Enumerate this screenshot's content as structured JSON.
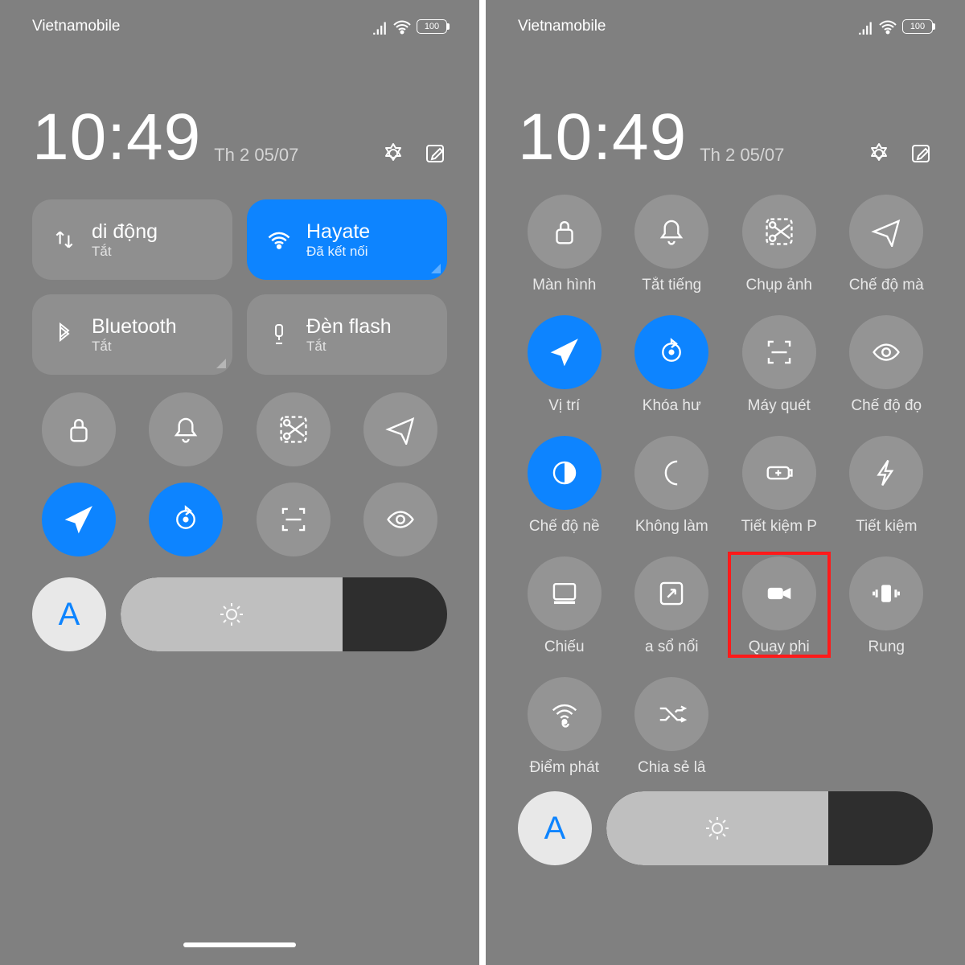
{
  "status": {
    "carrier": "Vietnamobile",
    "battery": "100"
  },
  "header": {
    "time": "10:49",
    "date": "Th 2 05/07"
  },
  "left": {
    "tiles": [
      {
        "title": "di động",
        "sub": "Tắt"
      },
      {
        "title": "Hayate",
        "sub": "Đã kết nối"
      },
      {
        "title": "Bluetooth",
        "sub": "Tắt"
      },
      {
        "title": "Đèn flash",
        "sub": "Tắt"
      }
    ],
    "auto_label": "A"
  },
  "right": {
    "toggles": [
      {
        "label": "Màn hình",
        "icon": "lock"
      },
      {
        "label": "Tắt tiếng",
        "icon": "bell"
      },
      {
        "label": "Chụp ảnh",
        "icon": "scissors"
      },
      {
        "label": "Chế độ mà",
        "icon": "plane"
      },
      {
        "label": "Vị trí",
        "icon": "location",
        "active": true
      },
      {
        "label": "Khóa hư",
        "icon": "rotate",
        "active": true
      },
      {
        "label": "Máy quét",
        "icon": "scan"
      },
      {
        "label": "Chế độ đọ",
        "icon": "eye"
      },
      {
        "label": "Chế độ nề",
        "icon": "contrast",
        "active": true
      },
      {
        "label": "Không làm",
        "icon": "moon"
      },
      {
        "label": "Tiết kiệm P",
        "icon": "battery-plus"
      },
      {
        "label": "Tiết kiệm",
        "icon": "bolt"
      },
      {
        "label": "Chiếu",
        "icon": "cast"
      },
      {
        "label": "a sổ nổi",
        "icon": "expand"
      },
      {
        "label": "Quay phi",
        "icon": "video",
        "highlight": true
      },
      {
        "label": "Rung",
        "icon": "vibrate"
      },
      {
        "label": "Điểm phát",
        "icon": "hotspot"
      },
      {
        "label": "Chia sẻ lâ",
        "icon": "shuffle"
      }
    ],
    "auto_label": "A"
  }
}
